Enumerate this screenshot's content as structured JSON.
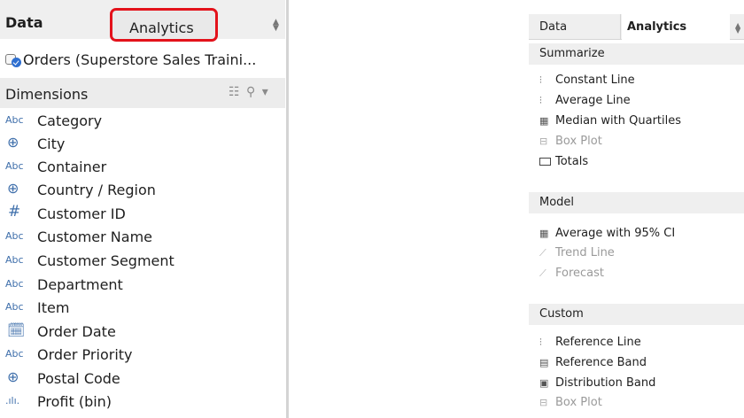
{
  "left_panel": {
    "tabs": {
      "data": "Data",
      "analytics": "Analytics"
    },
    "datasource": "Orders (Superstore Sales Traini...",
    "section": {
      "title": "Dimensions"
    },
    "dimensions": [
      {
        "icon": "Abc",
        "label": "Category"
      },
      {
        "icon": "⊕",
        "label": "City"
      },
      {
        "icon": "Abc",
        "label": "Container"
      },
      {
        "icon": "⊕",
        "label": "Country / Region"
      },
      {
        "icon": "#",
        "label": "Customer ID"
      },
      {
        "icon": "Abc",
        "label": "Customer Name"
      },
      {
        "icon": "Abc",
        "label": "Customer Segment"
      },
      {
        "icon": "Abc",
        "label": "Department"
      },
      {
        "icon": "Abc",
        "label": "Item"
      },
      {
        "icon": "🗓",
        "label": "Order Date"
      },
      {
        "icon": "Abc",
        "label": "Order Priority"
      },
      {
        "icon": "⊕",
        "label": "Postal Code"
      },
      {
        "icon": ".ılı.",
        "label": "Profit (bin)"
      }
    ]
  },
  "right_panel": {
    "tabs": {
      "data": "Data",
      "analytics": "Analytics"
    },
    "summarize": {
      "title": "Summarize",
      "items": [
        {
          "label": "Constant Line",
          "enabled": true
        },
        {
          "label": "Average Line",
          "enabled": true
        },
        {
          "label": "Median with Quartiles",
          "enabled": true
        },
        {
          "label": "Box Plot",
          "enabled": false
        },
        {
          "label": "Totals",
          "enabled": true
        }
      ]
    },
    "model": {
      "title": "Model",
      "items": [
        {
          "label": "Average with 95% CI",
          "enabled": true
        },
        {
          "label": "Trend Line",
          "enabled": false
        },
        {
          "label": "Forecast",
          "enabled": false
        }
      ]
    },
    "custom": {
      "title": "Custom",
      "items": [
        {
          "label": "Reference Line",
          "enabled": true
        },
        {
          "label": "Reference Band",
          "enabled": true
        },
        {
          "label": "Distribution Band",
          "enabled": true
        },
        {
          "label": "Box Plot",
          "enabled": false
        }
      ]
    }
  }
}
